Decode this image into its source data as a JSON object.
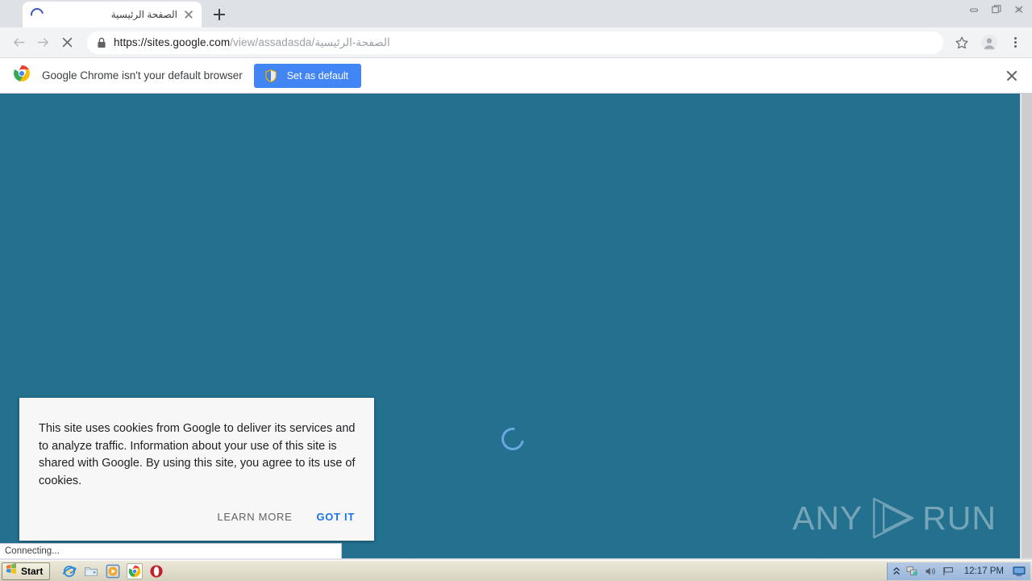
{
  "window": {
    "controls": [
      {
        "name": "minimize",
        "label": "Minimize"
      },
      {
        "name": "restore",
        "label": "Restore"
      },
      {
        "name": "close",
        "label": "Close"
      }
    ]
  },
  "tabstrip": {
    "tab": {
      "title": "الصفحة الرئيسية",
      "loading": true,
      "close_label": "Close tab",
      "spinner_icon": "loading-spinner-icon"
    },
    "new_tab_label": "New tab",
    "new_tab_icon": "plus-icon"
  },
  "toolbar": {
    "back_icon": "back-arrow-icon",
    "forward_icon": "forward-arrow-icon",
    "stop_icon": "stop-x-icon",
    "lock_icon": "lock-icon",
    "url_scheme": "https://",
    "url_host": "sites.google.com",
    "url_path": "/view/assadasda/الصفحة-الرئيسية",
    "url_full": "https://sites.google.com/view/assadasda/الصفحة-الرئيسية",
    "bookmark_icon": "star-icon",
    "avatar_icon": "profile-avatar-icon",
    "menu_icon": "three-dot-menu-icon"
  },
  "infobar": {
    "logo_icon": "chrome-logo-icon",
    "message": "Google Chrome isn't your default browser",
    "button_label": "Set as default",
    "button_icon": "shield-icon",
    "button_color": "#4285f4",
    "close_icon": "close-icon"
  },
  "page": {
    "background_color": "#24708f",
    "spinner_icon": "page-loading-spinner-icon",
    "spinner_color": "#6ba8e0",
    "cookie_banner": {
      "text": "This site uses cookies from Google to deliver its services and to analyze traffic. Information about your use of this site is shared with Google. By using this site, you agree to its use of cookies.",
      "learn_more_label": "LEARN MORE",
      "got_it_label": "GOT IT",
      "got_it_color": "#1a73e8",
      "background_color": "#f7f7f7"
    },
    "watermark": {
      "left_word": "ANY",
      "right_word": "RUN",
      "mark_icon": "anyrun-play-triangle-icon"
    },
    "status_text": "Connecting..."
  },
  "taskbar": {
    "start_label": "Start",
    "start_icon": "windows-flag-icon",
    "quicklaunch": [
      {
        "name": "internet-explorer",
        "icon": "internet-explorer-icon",
        "active": false
      },
      {
        "name": "file-explorer",
        "icon": "folder-icon",
        "active": false
      },
      {
        "name": "media-player",
        "icon": "media-player-icon",
        "active": false
      },
      {
        "name": "google-chrome",
        "icon": "chrome-icon",
        "active": true
      },
      {
        "name": "opera",
        "icon": "opera-icon",
        "active": false
      }
    ],
    "tray": [
      {
        "name": "show-hidden-icons",
        "icon": "chevron-up-icon"
      },
      {
        "name": "network-connection",
        "icon": "network-icon"
      },
      {
        "name": "volume",
        "icon": "speaker-icon"
      },
      {
        "name": "safely-remove",
        "icon": "eject-flag-icon"
      }
    ],
    "clock": "12:17 PM",
    "show_desktop_icon": "show-desktop-icon"
  }
}
